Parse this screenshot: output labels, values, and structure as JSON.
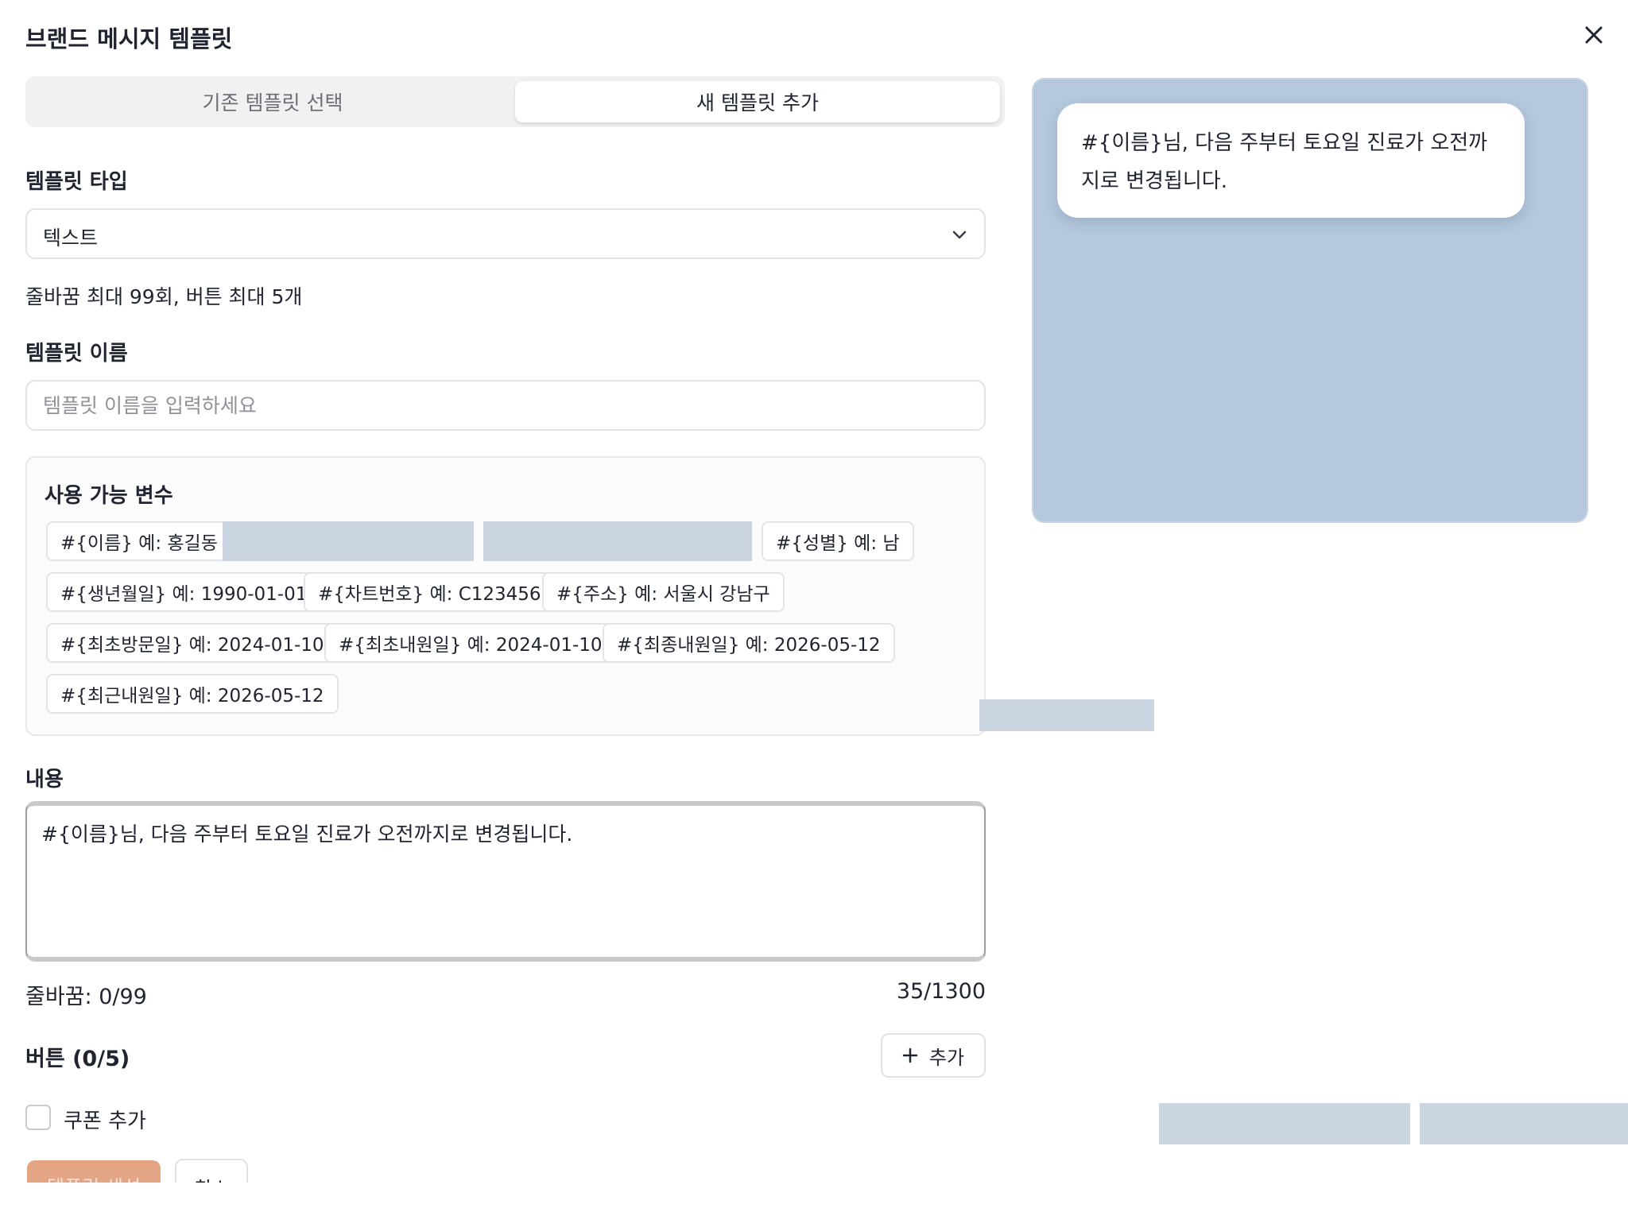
{
  "modal": {
    "title": "브랜드 메시지 템플릿"
  },
  "tabs": {
    "existing": "기존 템플릿 선택",
    "new": "새 템플릿 추가"
  },
  "template_type": {
    "label": "템플릿 타입",
    "value": "텍스트"
  },
  "limits_hint": "줄바꿈 최대 99회, 버튼 최대 5개",
  "template_name": {
    "label": "템플릿 이름",
    "placeholder": "템플릿 이름을 입력하세요",
    "value": ""
  },
  "variables": {
    "title": "사용 가능 변수",
    "items": [
      "#{이름} 예: 홍길동",
      "#{성별} 예: 남",
      "#{생년월일} 예: 1990-01-01",
      "#{차트번호} 예: C123456",
      "#{주소} 예: 서울시 강남구",
      "#{최초방문일} 예: 2024-01-10",
      "#{최초내원일} 예: 2024-01-10",
      "#{최종내원일} 예: 2026-05-12",
      "#{최근내원일} 예: 2026-05-12"
    ]
  },
  "content": {
    "label": "내용",
    "value": "#{이름}님, 다음 주부터 토요일 진료가 오전까지로 변경됩니다.",
    "line_breaks": "줄바꿈: 0/99",
    "char_count": "35/1300"
  },
  "buttons": {
    "label": "버튼 (0/5)",
    "add_label": "추가"
  },
  "coupon": {
    "label": "쿠폰 추가",
    "checked": false
  },
  "actions": {
    "create": "템플릿 생성",
    "cancel": "취소"
  },
  "preview": {
    "message": "#{이름}님, 다음 주부터 토요일 진료가 오전까지로 변경됩니다."
  },
  "colors": {
    "accent": "#e3a584",
    "preview_bg": "#b5c8de",
    "placeholder_block": "#cbd5e1"
  }
}
